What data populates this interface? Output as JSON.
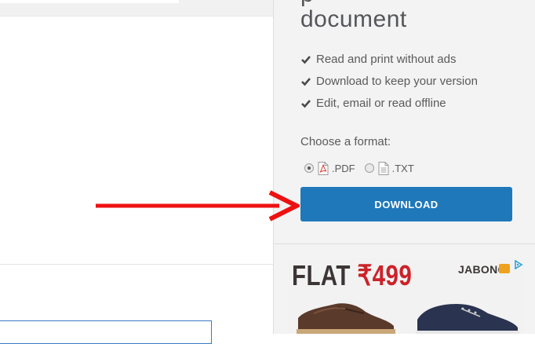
{
  "document_panel": {
    "title_partial": "p",
    "title": "document",
    "benefits": [
      "Read and print without ads",
      "Download to keep your version",
      "Edit, email or read offline"
    ],
    "format_label": "Choose a format:",
    "formats": [
      {
        "label": ".PDF",
        "selected": true,
        "icon": "pdf-file-icon"
      },
      {
        "label": ".TXT",
        "selected": false,
        "icon": "txt-file-icon"
      }
    ],
    "download_label": "DOWNLOAD",
    "button_color": "#1f78ba"
  },
  "annotation": {
    "icon": "red-arrow-icon",
    "color": "#ee1111"
  },
  "ad": {
    "flat_text": "FLAT",
    "price_text": "₹499",
    "brand": "JABONG",
    "brand_badge": "cult",
    "choices_icon": "adchoices-icon",
    "products": [
      "brown-sneaker",
      "navy-shoe"
    ]
  }
}
